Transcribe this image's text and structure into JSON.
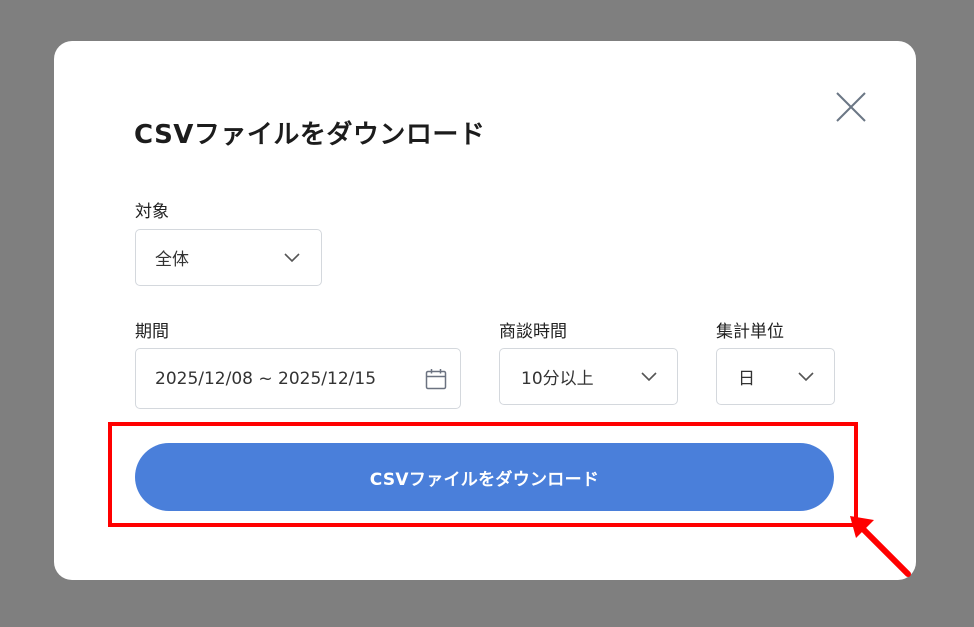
{
  "dialog": {
    "title": "CSVファイルをダウンロード",
    "close_icon": "close-icon"
  },
  "target": {
    "label": "対象",
    "value": "全体"
  },
  "period": {
    "label": "期間",
    "value": "2025/12/08 ~ 2025/12/15",
    "icon": "calendar-icon"
  },
  "duration": {
    "label": "商談時間",
    "value": "10分以上"
  },
  "unit": {
    "label": "集計単位",
    "value": "日"
  },
  "download_button": {
    "label": "CSVファイルをダウンロード",
    "color": "#4a7fda"
  },
  "annotation": {
    "highlight_color": "#ff0000",
    "arrow_color": "#ff0000"
  }
}
